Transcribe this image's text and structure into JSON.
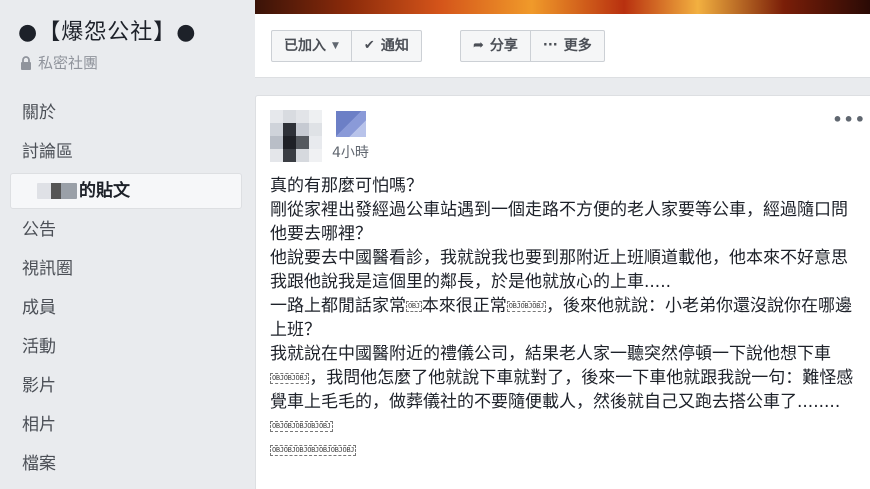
{
  "group": {
    "name": "●【爆怨公社】●",
    "privacy": "私密社團"
  },
  "sidebar": {
    "items": [
      {
        "label": "關於"
      },
      {
        "label": "討論區"
      },
      {
        "label": "的貼文"
      },
      {
        "label": "公告"
      },
      {
        "label": "視訊圈"
      },
      {
        "label": "成員"
      },
      {
        "label": "活動"
      },
      {
        "label": "影片"
      },
      {
        "label": "相片"
      },
      {
        "label": "檔案"
      }
    ]
  },
  "actions": {
    "joined": "已加入",
    "notify": "通知",
    "share": "分享",
    "more": "更多"
  },
  "post": {
    "time": "4小時",
    "more_label": "•••",
    "paragraphs": {
      "p1": "真的有那麼可怕嗎？",
      "p2": "剛從家裡出發經過公車站遇到一個走路不方便的老人家要等公車，經過隨口問他要去哪裡？",
      "p3": "他說要去中國醫看診，我就說我也要到那附近上班順道載他，他本來不好意思我跟他說我是這個里的鄰長，於是他就放心的上車.....",
      "p4a": "一路上都閒話家常",
      "p4b": "本來很正常",
      "p4c": "，後來他就說：小老弟你還沒說你在哪邊上班？",
      "p5a": "我就說在中國醫附近的禮儀公司，結果老人家一聽突然停頓一下說他想下車",
      "p5b": "，我問他怎麼了他就說下車就對了，後來一下車他就跟我說一句：難怪感覺車上毛毛的，做葬儀社的不要隨便載人，然後就自己又跑去搭公車了........"
    },
    "obj1": "OBJ",
    "obj2": "OBJOBJOBJ",
    "obj3": "OBJOBJOBJ",
    "obj4": "OBJOBJOBJOBJOBJ",
    "obj5": "OBJOBJOBJOBJOBJOBJOBJ"
  },
  "colors": {
    "background": "#e9ebee",
    "card": "#ffffff",
    "text": "#1d2129",
    "muted": "#90949c"
  }
}
